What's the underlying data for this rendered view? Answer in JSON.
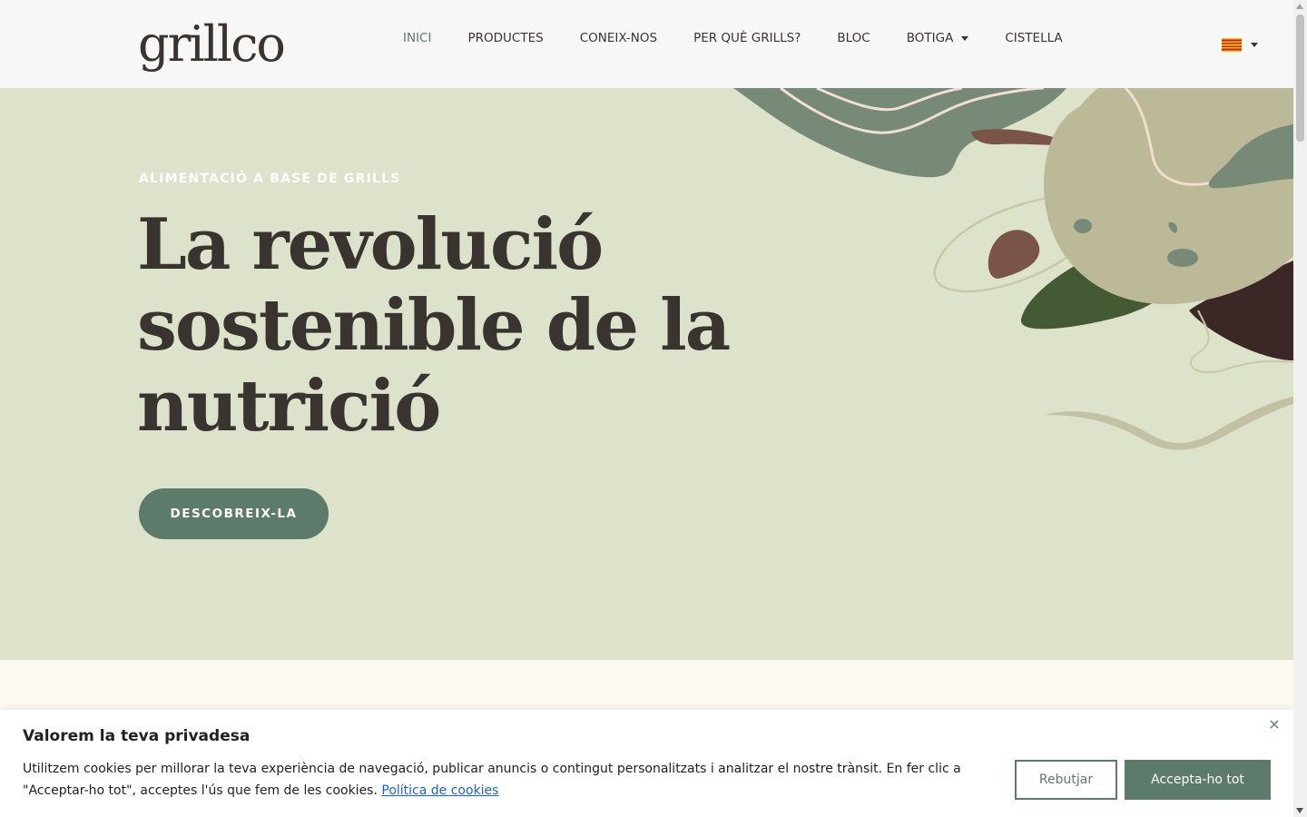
{
  "header": {
    "logo": "grillco",
    "nav": [
      {
        "label": "INICI",
        "active": true,
        "dropdown": false
      },
      {
        "label": "PRODUCTES",
        "active": false,
        "dropdown": false
      },
      {
        "label": "CONEIX-NOS",
        "active": false,
        "dropdown": false
      },
      {
        "label": "PER QUÈ GRILLS?",
        "active": false,
        "dropdown": false
      },
      {
        "label": "BLOC",
        "active": false,
        "dropdown": false
      },
      {
        "label": "BOTIGA",
        "active": false,
        "dropdown": true
      },
      {
        "label": "CISTELLA",
        "active": false,
        "dropdown": false
      }
    ],
    "language_flag": "catalan-flag-icon"
  },
  "hero": {
    "eyebrow": "ALIMENTACIÓ A BASE DE GRILLS",
    "headline_line1": "La revolució",
    "headline_line2": "sostenible de la",
    "headline_line3": "nutrició",
    "cta_label": "DESCOBREIX-LA"
  },
  "cookie_banner": {
    "title": "Valorem la teva privadesa",
    "text": "Utilitzem cookies per millorar la teva experiència de navegació, publicar anuncis o contingut personalitzats i analitzar el nostre trànsit. En fer clic a \"Acceptar-ho tot\", acceptes l'ús que fem de les cookies.",
    "link_label": "Política de cookies",
    "reject_label": "Rebutjar",
    "accept_label": "Accepta-ho tot",
    "close_icon": "×"
  },
  "colors": {
    "accent": "#5d7b6a",
    "hero_bg": "#dde3ca",
    "text_dark": "#3a3431",
    "link": "#1863dc"
  }
}
